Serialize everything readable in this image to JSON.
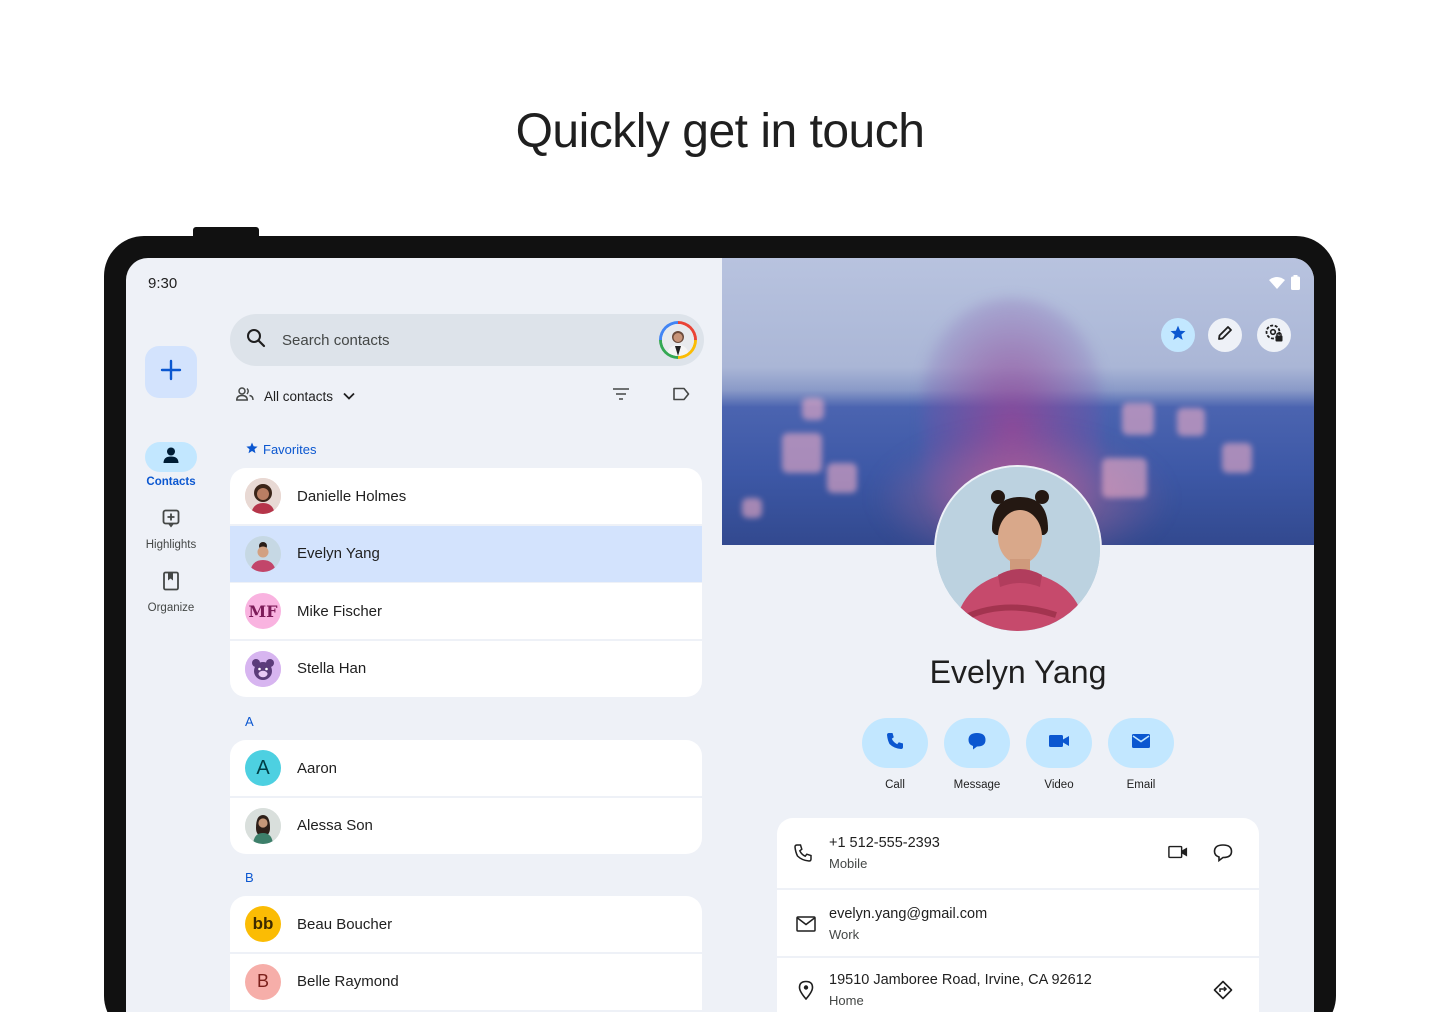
{
  "headline": "Quickly get in touch",
  "status": {
    "time": "9:30"
  },
  "nav": {
    "items": [
      {
        "label": "Contacts",
        "active": true
      },
      {
        "label": "Highlights",
        "active": false
      },
      {
        "label": "Organize",
        "active": false
      }
    ]
  },
  "search": {
    "placeholder": "Search contacts"
  },
  "filter": {
    "label": "All contacts"
  },
  "sections": {
    "favorites": "Favorites",
    "a": "A",
    "b": "B"
  },
  "contacts": {
    "favorites": [
      {
        "name": "Danielle Holmes",
        "avatar": "photo"
      },
      {
        "name": "Evelyn Yang",
        "avatar": "photo",
        "selected": true
      },
      {
        "name": "Mike Fischer",
        "avatar": "MF"
      },
      {
        "name": "Stella Han",
        "avatar": "bear"
      }
    ],
    "a": [
      {
        "name": "Aaron",
        "avatar": "A"
      },
      {
        "name": "Alessa Son",
        "avatar": "photo"
      }
    ],
    "b": [
      {
        "name": "Beau Boucher",
        "avatar": "bb"
      },
      {
        "name": "Belle Raymond",
        "avatar": "B"
      }
    ]
  },
  "profile": {
    "name": "Evelyn Yang",
    "actions": [
      {
        "label": "Call",
        "icon": "phone-icon"
      },
      {
        "label": "Message",
        "icon": "message-icon"
      },
      {
        "label": "Video",
        "icon": "video-icon"
      },
      {
        "label": "Email",
        "icon": "email-icon"
      }
    ],
    "phone": {
      "value": "+1 512-555-2393",
      "type": "Mobile"
    },
    "email": {
      "value": "evelyn.yang@gmail.com",
      "type": "Work"
    },
    "address": {
      "value": "19510 Jamboree Road, Irvine, CA 92612",
      "type": "Home"
    }
  },
  "colors": {
    "accent": "#0b57d0",
    "selected_row": "#d3e3fd",
    "action_button": "#c2e7ff",
    "background": "#eef1f7"
  }
}
